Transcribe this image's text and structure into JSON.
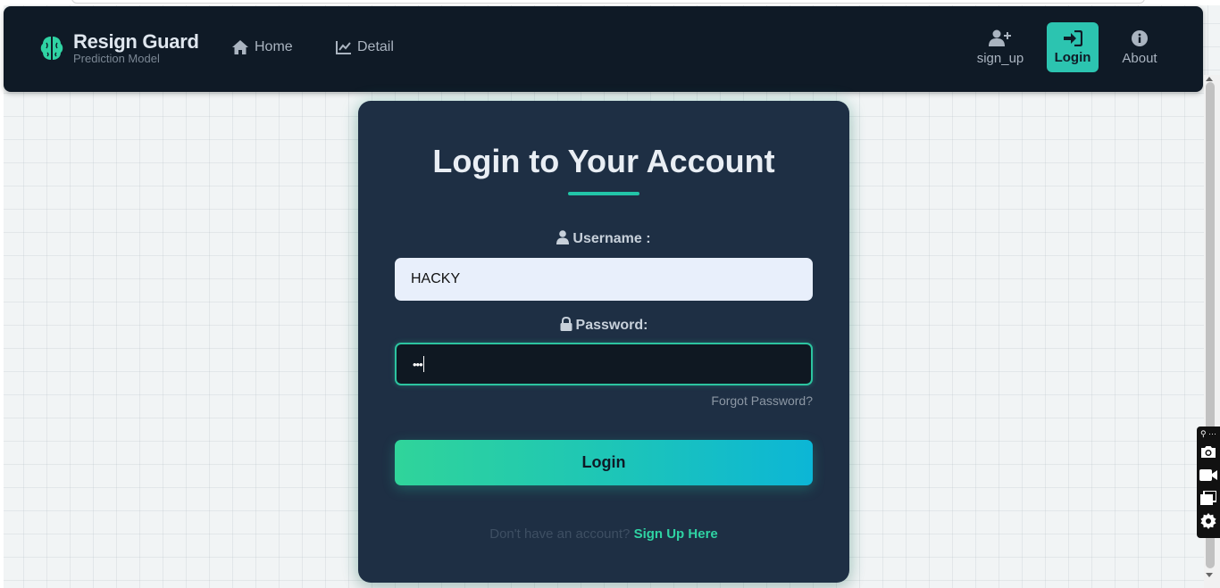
{
  "brand": {
    "title": "Resign Guard",
    "subtitle": "Prediction Model",
    "logo_icon": "brain-icon"
  },
  "nav": {
    "home_label": "Home",
    "detail_label": "Detail",
    "signup_label": "sign_up",
    "login_label": "Login",
    "about_label": "About",
    "active": "Login"
  },
  "form": {
    "title": "Login to Your Account",
    "username_label": "Username :",
    "username_value": "HACKY",
    "password_label": "Password:",
    "password_mask": "•••",
    "forgot_label": "Forgot Password?",
    "submit_label": "Login",
    "signup_prompt": "Don't have an account?",
    "signup_link": "Sign Up Here"
  },
  "floating_toolbar": {
    "top_label": "⚲ ···",
    "items": [
      "camera-icon",
      "video-icon",
      "window-icon",
      "gear-icon"
    ]
  },
  "colors": {
    "nav_bg": "#0f1a26",
    "card_bg": "#1e2f44",
    "accent": "#2cc4b0",
    "gradient_start": "#30d49a",
    "gradient_end": "#0cb6d6"
  }
}
